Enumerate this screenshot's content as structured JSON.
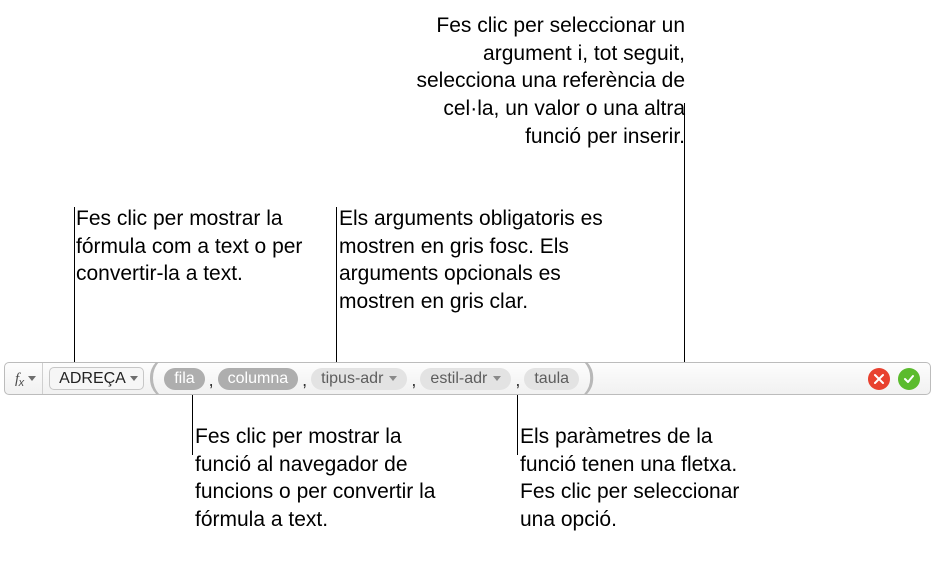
{
  "callouts": {
    "top_right": "Fes clic per seleccionar un argument i, tot seguit, selecciona una referència de cel·la, un valor o una altra funció per inserir.",
    "top_left": "Fes clic per mostrar la fórmula com a text o per convertir-la a text.",
    "top_mid": "Els arguments obligatoris es mostren en gris fosc. Els arguments opcionals es mostren en gris clar.",
    "bottom_left": "Fes clic per mostrar la funció al navegador de funcions o per convertir la fórmula a text.",
    "bottom_right": "Els paràmetres de la funció tenen una fletxa. Fes clic per seleccionar una opció."
  },
  "formula_bar": {
    "fx_label": "f",
    "fx_sub": "x",
    "function_name": "ADREÇA",
    "args": [
      {
        "label": "fila",
        "required": true,
        "has_dropdown": false
      },
      {
        "label": "columna",
        "required": true,
        "has_dropdown": false
      },
      {
        "label": "tipus-adr",
        "required": false,
        "has_dropdown": true
      },
      {
        "label": "estil-adr",
        "required": false,
        "has_dropdown": true
      },
      {
        "label": "taula",
        "required": false,
        "has_dropdown": false
      }
    ]
  }
}
